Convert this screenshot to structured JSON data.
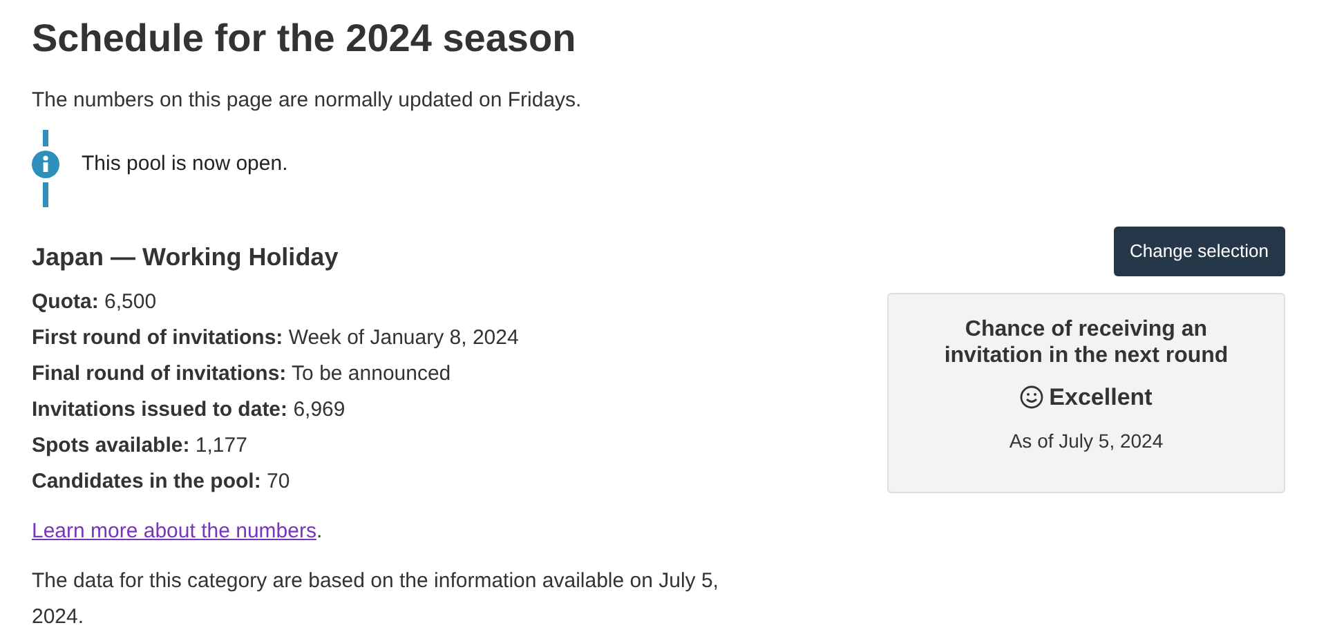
{
  "title": "Schedule for the 2024 season",
  "intro": "The numbers on this page are normally updated on Fridays.",
  "notice": {
    "text": "This pool is now open."
  },
  "category": {
    "heading": "Japan — Working Holiday",
    "button": "Change selection"
  },
  "facts": [
    {
      "label": "Quota:",
      "value": "6,500"
    },
    {
      "label": "First round of invitations:",
      "value": "Week of January 8, 2024"
    },
    {
      "label": "Final round of invitations:",
      "value": "To be announced"
    },
    {
      "label": "Invitations issued to date:",
      "value": "6,969"
    },
    {
      "label": "Spots available:",
      "value": "1,177"
    },
    {
      "label": "Candidates in the pool:",
      "value": "70"
    }
  ],
  "learn_more": {
    "link": "Learn more about the numbers",
    "suffix": "."
  },
  "footnote": "The data for this category are based on the information available on July 5, 2024.",
  "chance_card": {
    "heading": "Chance of receiving an invitation in the next round",
    "rating": "Excellent",
    "as_of": "As of July 5, 2024"
  }
}
